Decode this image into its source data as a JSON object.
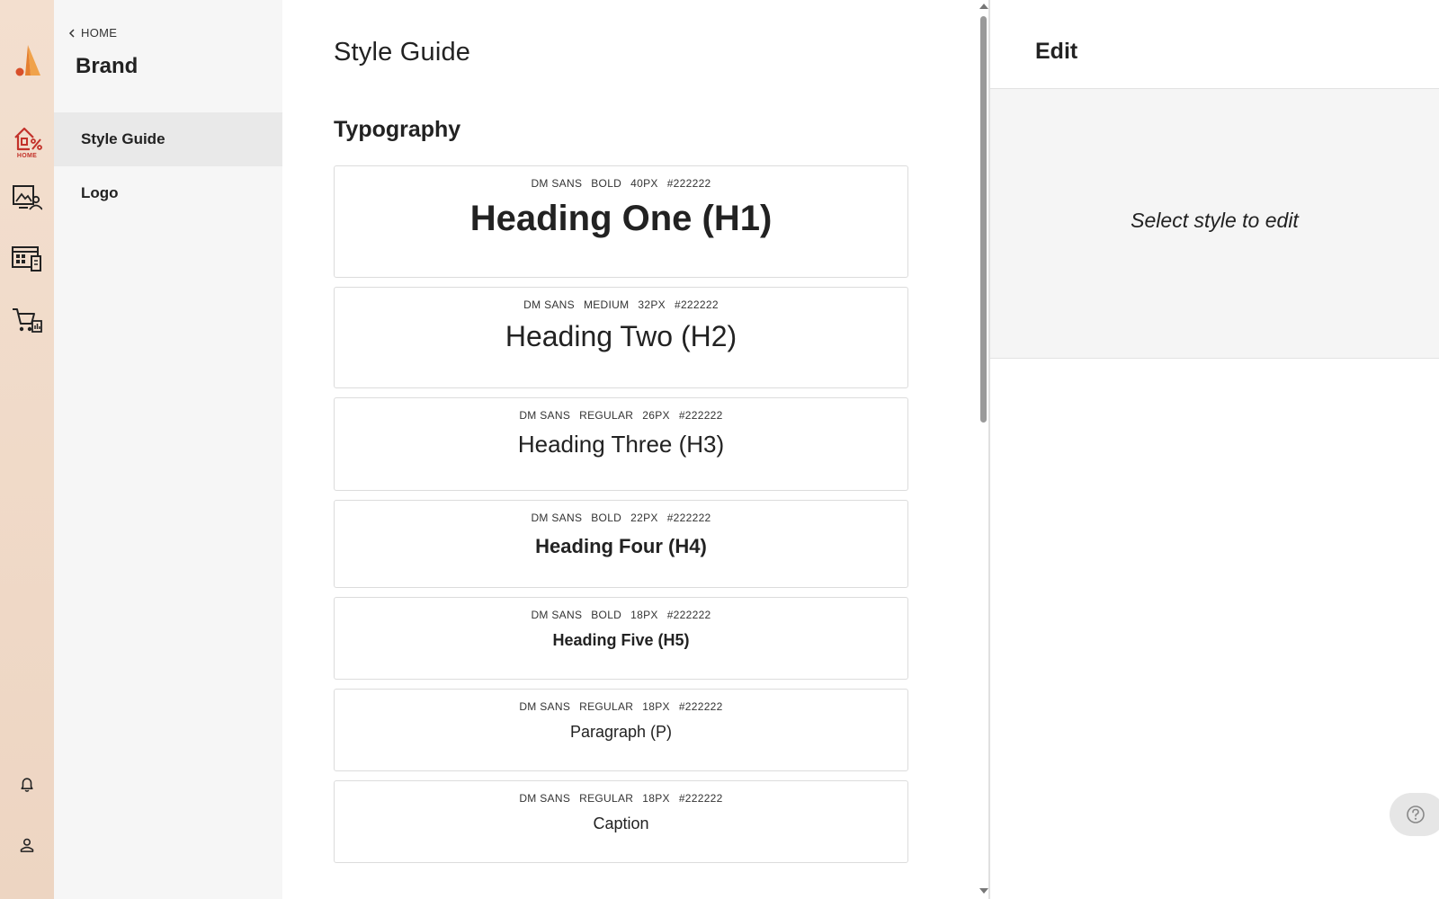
{
  "rail": {
    "home_label": "HOME",
    "accent": "#c3322a",
    "items": [
      {
        "icon": "store-discount-icon",
        "label": "HOME"
      },
      {
        "icon": "image-user-icon"
      },
      {
        "icon": "dashboard-grid-icon"
      },
      {
        "icon": "cart-chart-icon"
      }
    ],
    "bottom": [
      {
        "icon": "bell-icon"
      },
      {
        "icon": "user-icon"
      }
    ]
  },
  "sidebar": {
    "back_label": "HOME",
    "title": "Brand",
    "items": [
      {
        "label": "Style Guide",
        "active": true
      },
      {
        "label": "Logo",
        "active": false
      }
    ]
  },
  "main": {
    "title": "Style Guide",
    "section": "Typography",
    "styles": [
      {
        "font": "DM SANS",
        "weight": "BOLD",
        "size": "40PX",
        "color": "#222222",
        "sample": "Heading One (H1)"
      },
      {
        "font": "DM SANS",
        "weight": "MEDIUM",
        "size": "32PX",
        "color": "#222222",
        "sample": "Heading Two (H2)"
      },
      {
        "font": "DM SANS",
        "weight": "REGULAR",
        "size": "26PX",
        "color": "#222222",
        "sample": "Heading Three (H3)"
      },
      {
        "font": "DM SANS",
        "weight": "BOLD",
        "size": "22PX",
        "color": "#222222",
        "sample": "Heading Four (H4)"
      },
      {
        "font": "DM SANS",
        "weight": "BOLD",
        "size": "18PX",
        "color": "#222222",
        "sample": "Heading Five (H5)"
      },
      {
        "font": "DM SANS",
        "weight": "REGULAR",
        "size": "18PX",
        "color": "#222222",
        "sample": "Paragraph (P)"
      },
      {
        "font": "DM SANS",
        "weight": "REGULAR",
        "size": "18PX",
        "color": "#222222",
        "sample": "Caption"
      }
    ]
  },
  "edit": {
    "title": "Edit",
    "placeholder": "Select style to edit"
  },
  "help": {
    "icon": "help-circle-icon"
  }
}
